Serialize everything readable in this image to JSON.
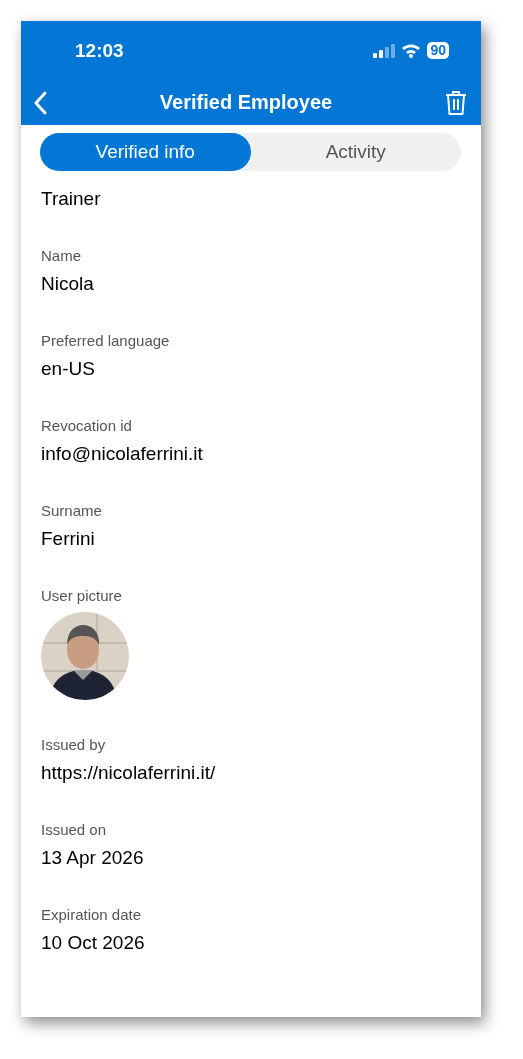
{
  "status_bar": {
    "time": "12:03",
    "battery": "90"
  },
  "nav_bar": {
    "title": "Verified Employee"
  },
  "tabs": [
    {
      "label": "Verified info",
      "selected": true
    },
    {
      "label": "Activity",
      "selected": false
    }
  ],
  "fields": [
    {
      "kind": "text",
      "value": "Trainer"
    },
    {
      "kind": "text",
      "label": "Name",
      "value": "Nicola"
    },
    {
      "kind": "text",
      "label": "Preferred language",
      "value": "en-US"
    },
    {
      "kind": "text",
      "label": "Revocation id",
      "value": "info@nicolaferrini.it"
    },
    {
      "kind": "text",
      "label": "Surname",
      "value": "Ferrini"
    },
    {
      "kind": "picture",
      "label": "User picture"
    },
    {
      "kind": "text",
      "label": "Issued by",
      "value": "https://nicolaferrini.it/"
    },
    {
      "kind": "text",
      "label": "Issued on",
      "value": "13 Apr 2026"
    },
    {
      "kind": "text",
      "label": "Expiration date",
      "value": "10 Oct 2026"
    }
  ]
}
